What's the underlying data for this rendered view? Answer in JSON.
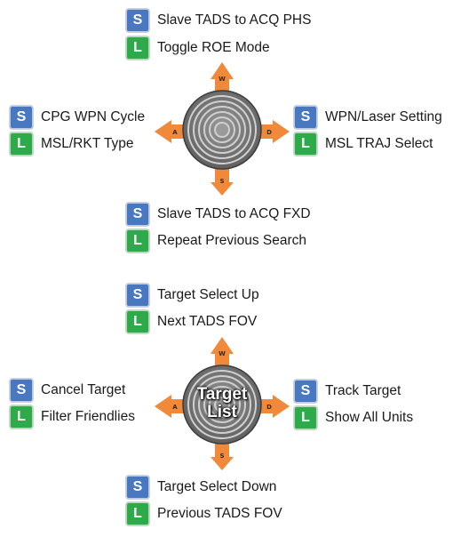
{
  "colors": {
    "short_badge": "#4a78c0",
    "long_badge": "#2eaa4a",
    "arrow": "#f08a3a",
    "ring_dark": "#5a5a5a",
    "ring_light": "#a8a8a8"
  },
  "badges": {
    "short": "S",
    "long": "L"
  },
  "hats": [
    {
      "center_label": "",
      "directions": {
        "up": "W",
        "left": "A",
        "right": "D",
        "down": "S"
      },
      "up": {
        "short": "Slave TADS to ACQ PHS",
        "long": "Toggle ROE Mode"
      },
      "left": {
        "short": "CPG WPN Cycle",
        "long": "MSL/RKT Type"
      },
      "right": {
        "short": "WPN/Laser Setting",
        "long": "MSL TRAJ Select"
      },
      "down": {
        "short": "Slave TADS to ACQ FXD",
        "long": "Repeat Previous Search"
      }
    },
    {
      "center_label": "Target List",
      "directions": {
        "up": "W",
        "left": "A",
        "right": "D",
        "down": "S"
      },
      "up": {
        "short": "Target Select Up",
        "long": "Next TADS FOV"
      },
      "left": {
        "short": "Cancel Target",
        "long": "Filter Friendlies"
      },
      "right": {
        "short": "Track Target",
        "long": "Show All Units"
      },
      "down": {
        "short": "Target Select Down",
        "long": "Previous TADS FOV"
      }
    }
  ]
}
